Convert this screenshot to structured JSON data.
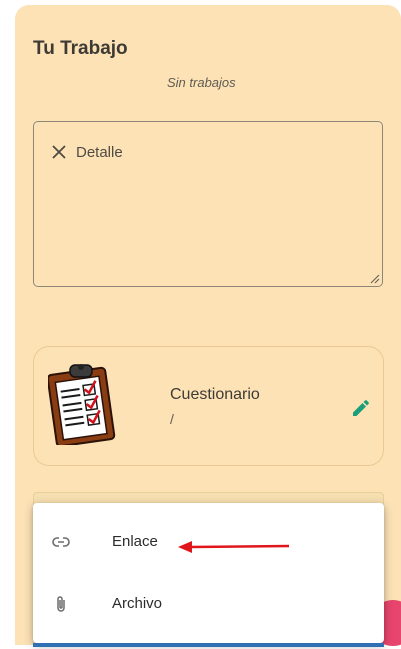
{
  "work": {
    "title": "Tu Trabajo",
    "status": "Sin trabajos",
    "detail_label": "Detalle"
  },
  "quiz": {
    "name": "Cuestionario",
    "subtitle": "/"
  },
  "menu": {
    "items": [
      {
        "label": "Enlace",
        "icon": "link-icon"
      },
      {
        "label": "Archivo",
        "icon": "attachment-icon"
      }
    ]
  },
  "colors": {
    "panel_bg": "#fde2b6",
    "accent_green": "#1a9f7a",
    "fab_pink": "#e8456e",
    "annotation_red": "#e0161b"
  }
}
